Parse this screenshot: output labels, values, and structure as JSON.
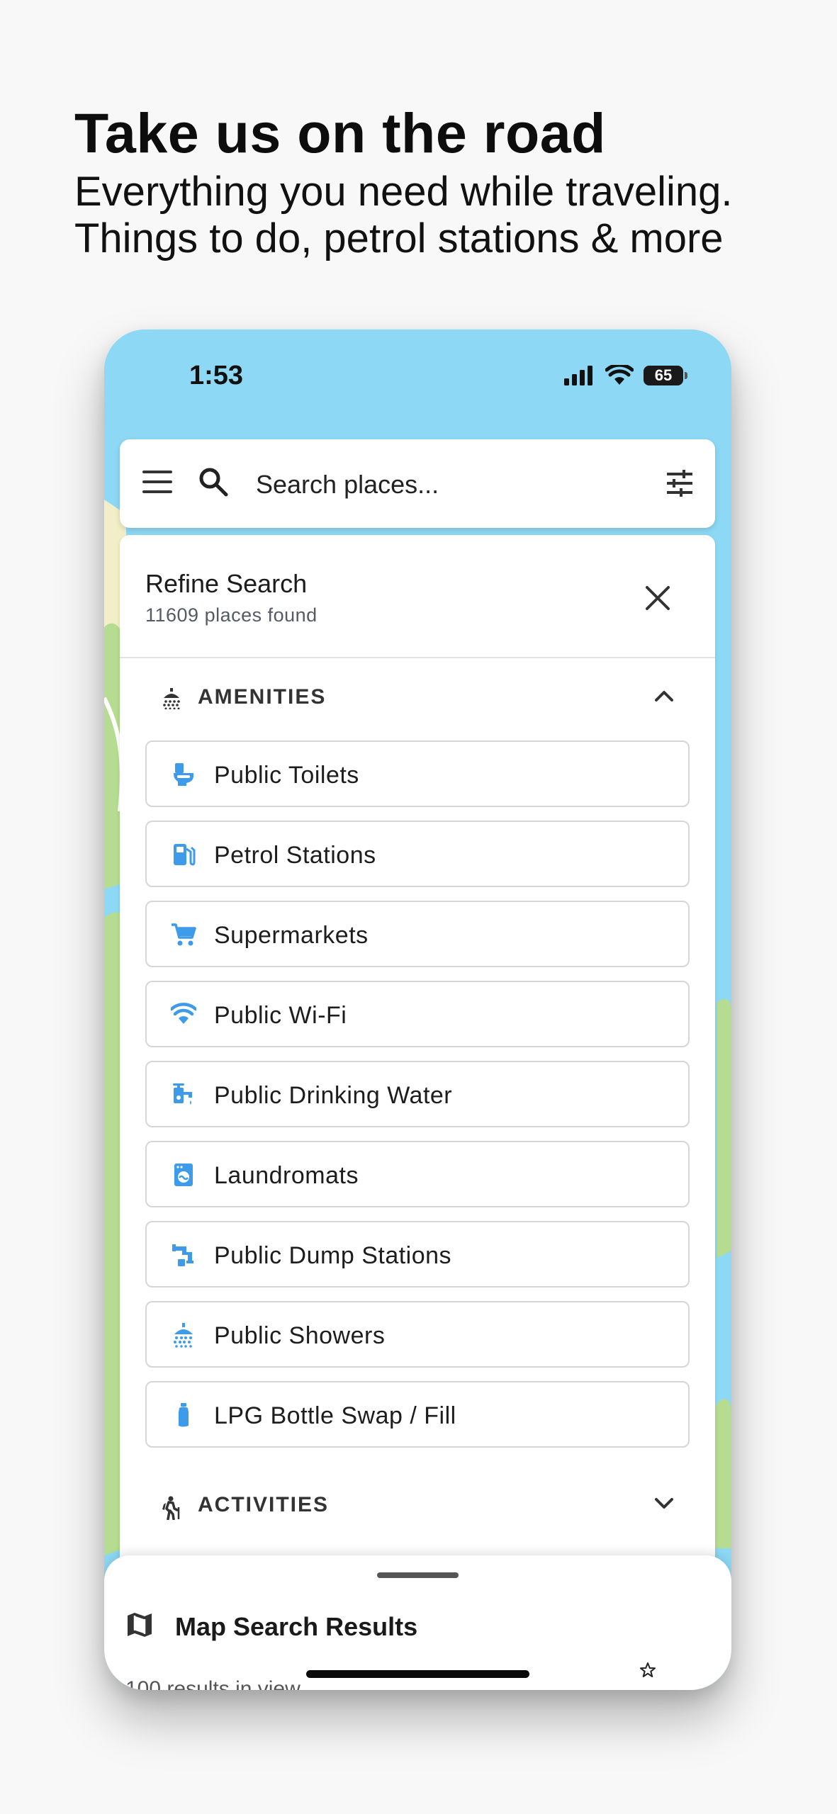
{
  "promo": {
    "headline": "Take us on the road",
    "subline": "Everything you need while traveling. Things to do, petrol stations & more"
  },
  "status_bar": {
    "time": "1:53",
    "battery": "65"
  },
  "search": {
    "placeholder": "Search places..."
  },
  "refine": {
    "title": "Refine Search",
    "count": "11609 places found"
  },
  "amenities": {
    "label": "AMENITIES",
    "items": [
      {
        "label": "Public Toilets",
        "icon": "toilet-icon"
      },
      {
        "label": "Petrol Stations",
        "icon": "fuel-pump-icon"
      },
      {
        "label": "Supermarkets",
        "icon": "shopping-cart-icon"
      },
      {
        "label": "Public Wi-Fi",
        "icon": "wifi-icon"
      },
      {
        "label": "Public Drinking Water",
        "icon": "water-tap-icon"
      },
      {
        "label": "Laundromats",
        "icon": "washing-machine-icon"
      },
      {
        "label": "Public Dump Stations",
        "icon": "dump-station-icon"
      },
      {
        "label": "Public Showers",
        "icon": "shower-icon"
      },
      {
        "label": "LPG Bottle Swap / Fill",
        "icon": "gas-bottle-icon"
      }
    ]
  },
  "activities": {
    "label": "ACTIVITIES"
  },
  "results_sheet": {
    "title": "Map Search Results",
    "subtitle": "100 results in view"
  },
  "colors": {
    "icon_blue": "#3d9be9",
    "map_water": "#8dd9f5",
    "map_park": "#b5dc90",
    "map_sand": "#f2eec7"
  }
}
